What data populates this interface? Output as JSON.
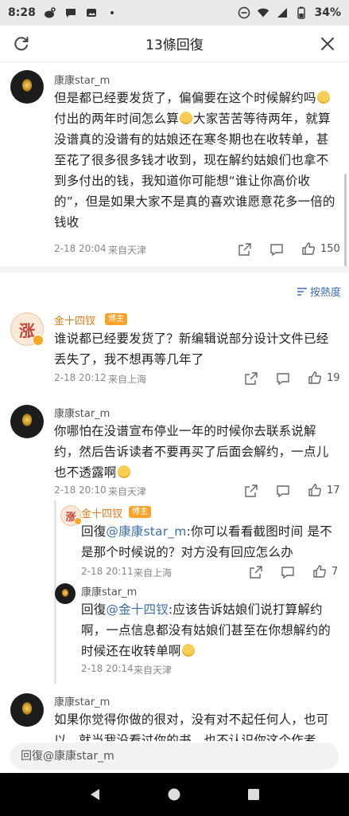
{
  "status_bar": {
    "time": "8:28",
    "battery": "34%"
  },
  "header": {
    "title": "13條回復"
  },
  "comments": [
    {
      "name": "康康star_m",
      "text_parts": [
        "但是都已经要发货了，偏偏要在这个时候解约吗",
        "付出的两年时间怎么算",
        "大家苦苦等待两年，就算没谱真的没谱有的姑娘还在寒冬期也在收转单，甚至花了很多很多钱才收到，现在解约姑娘们也拿不到多付出的钱，我知道你可能想“谁让你高价收的”，但是如果大家不是真的喜欢谁愿意花多一倍的钱收"
      ],
      "date": "2-18 20:04",
      "location": "来自天津",
      "likes": "150"
    },
    {
      "sort_label": "按熱度"
    },
    {
      "name": "金十四钗",
      "badge": "博主",
      "avatar_char": "涨",
      "text": "谁说都已经要发货了？新编辑说部分设计文件已经丢失了，我不想再等几年了",
      "date": "2-18 20:12",
      "location": "来自上海",
      "likes": "19"
    },
    {
      "name": "康康star_m",
      "text": "你哪怕在没谱宣布停业一年的时候你去联系说解约，然后告诉读者不要再买了后面会解约，一点儿也不透露啊",
      "date": "2-18 20:10",
      "location": "来自天津",
      "likes": "17"
    },
    {
      "name": "金十四钗",
      "badge": "博主",
      "avatar_char": "涨",
      "reply_prefix": "回復",
      "mention": "@康康star_m",
      "text": ":你可以看看截图时间 是不是那个时候说的？对方没有回应怎么办",
      "date": "2-18 20:11",
      "location": "来自上海",
      "likes": "7"
    },
    {
      "name": "康康star_m",
      "reply_prefix": "回復",
      "mention": "@金十四钗",
      "text": ":应该告诉姑娘们说打算解约啊，一点信息都没有姑娘们甚至在你想解约的时候还在收转单啊",
      "date": "2-18 20:14",
      "location": "来自天津"
    },
    {
      "name": "康康star_m",
      "text": "如果你觉得你做的很对，没有对不起任何人，也可以，就当我没看过你的书，也不认识你这个作者，"
    }
  ],
  "reply_input": {
    "placeholder": "回復@康康star_m"
  },
  "colors": {
    "accent": "#3d6ea8",
    "blogger": "#e07b16",
    "badge": "#f7a32c"
  },
  "icons": [
    "refresh-icon",
    "close-icon",
    "share-icon",
    "comment-icon",
    "like-icon",
    "sort-icon",
    "back-icon",
    "home-icon",
    "recents-icon"
  ]
}
